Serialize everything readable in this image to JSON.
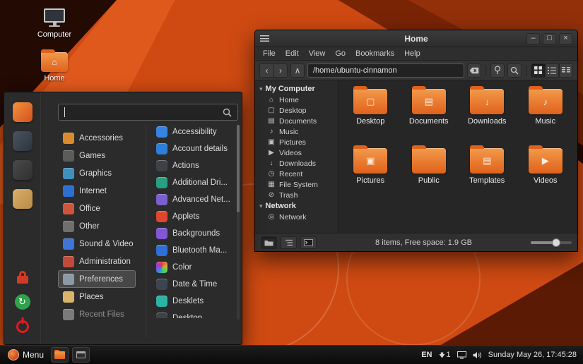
{
  "desktop": {
    "icons": [
      {
        "label": "Computer"
      },
      {
        "label": "Home",
        "emblem": "⌂"
      }
    ]
  },
  "menu": {
    "search": {
      "value": "",
      "placeholder": ""
    },
    "favorites": [
      {
        "name": "software-store",
        "color": "linear-gradient(135deg,#f0923f,#d4511c)"
      },
      {
        "name": "settings",
        "color": "linear-gradient(135deg,#4a5562,#2c333d)"
      },
      {
        "name": "terminal",
        "color": "linear-gradient(135deg,#4a4a4a,#303030)"
      },
      {
        "name": "files",
        "color": "linear-gradient(135deg,#d9b06c,#b98a45)"
      }
    ],
    "categories": [
      {
        "label": "Accessories",
        "icon_color": "#d98b2b"
      },
      {
        "label": "Games",
        "icon_color": "#5c5c5c"
      },
      {
        "label": "Graphics",
        "icon_color": "#3f8fbf"
      },
      {
        "label": "Internet",
        "icon_color": "#2d6fd0"
      },
      {
        "label": "Office",
        "icon_color": "#d0543a"
      },
      {
        "label": "Other",
        "icon_color": "#6f6f6f"
      },
      {
        "label": "Sound & Video",
        "icon_color": "#3f74d9"
      },
      {
        "label": "Administration",
        "icon_color": "#c24a3a"
      },
      {
        "label": "Preferences",
        "icon_color": "#8d99a5",
        "selected": true
      },
      {
        "label": "Places",
        "icon_color": "#d9b36a"
      },
      {
        "label": "Recent Files",
        "icon_color": "#7a7a7a",
        "dimmed": true
      }
    ],
    "applications": [
      {
        "label": "Accessibility",
        "icon_color": "#3584e4"
      },
      {
        "label": "Account details",
        "icon_color": "#2d7fd9"
      },
      {
        "label": "Actions",
        "icon_color": "#3d4248"
      },
      {
        "label": "Additional Dri...",
        "icon_color": "#26a081"
      },
      {
        "label": "Advanced Net...",
        "icon_color": "#7a5fd0"
      },
      {
        "label": "Applets",
        "icon_color": "#e0452e"
      },
      {
        "label": "Backgrounds",
        "icon_color": "#8257d6"
      },
      {
        "label": "Bluetooth Ma...",
        "icon_color": "#2f6fd8"
      },
      {
        "label": "Color",
        "icon_color": "#d9a13a",
        "rainbow": true
      },
      {
        "label": "Date & Time",
        "icon_color": "#3c4450"
      },
      {
        "label": "Desklets",
        "icon_color": "#2bb3a3"
      },
      {
        "label": "Desktop",
        "icon_color": "#3d4248"
      }
    ]
  },
  "window": {
    "title": "Home",
    "menubar": [
      "File",
      "Edit",
      "View",
      "Go",
      "Bookmarks",
      "Help"
    ],
    "toolbar": {
      "path": "/home/ubuntu-cinnamon"
    },
    "sidebar": {
      "sections": [
        {
          "label": "My Computer",
          "items": [
            {
              "label": "Home",
              "glyph": "⌂"
            },
            {
              "label": "Desktop",
              "glyph": "▢"
            },
            {
              "label": "Documents",
              "glyph": "▤"
            },
            {
              "label": "Music",
              "glyph": "♪"
            },
            {
              "label": "Pictures",
              "glyph": "▣"
            },
            {
              "label": "Videos",
              "glyph": "▶"
            },
            {
              "label": "Downloads",
              "glyph": "↓"
            },
            {
              "label": "Recent",
              "glyph": "◷"
            },
            {
              "label": "File System",
              "glyph": "▦"
            },
            {
              "label": "Trash",
              "glyph": "⊘"
            }
          ]
        },
        {
          "label": "Network",
          "items": [
            {
              "label": "Network",
              "glyph": "◎"
            }
          ]
        }
      ]
    },
    "files": [
      {
        "label": "Desktop",
        "emblem": "▢"
      },
      {
        "label": "Documents",
        "emblem": "▤"
      },
      {
        "label": "Downloads",
        "emblem": "↓"
      },
      {
        "label": "Music",
        "emblem": "♪"
      },
      {
        "label": "Pictures",
        "emblem": "▣"
      },
      {
        "label": "Public",
        "emblem": ""
      },
      {
        "label": "Templates",
        "emblem": "▤"
      },
      {
        "label": "Videos",
        "emblem": "▶"
      }
    ],
    "statusbar": {
      "text": "8 items, Free space: 1.9 GB"
    }
  },
  "panel": {
    "menu_label": "Menu",
    "keyboard_layout": "EN",
    "notification_count": "1",
    "clock": "Sunday May 26, 17:45:28"
  }
}
